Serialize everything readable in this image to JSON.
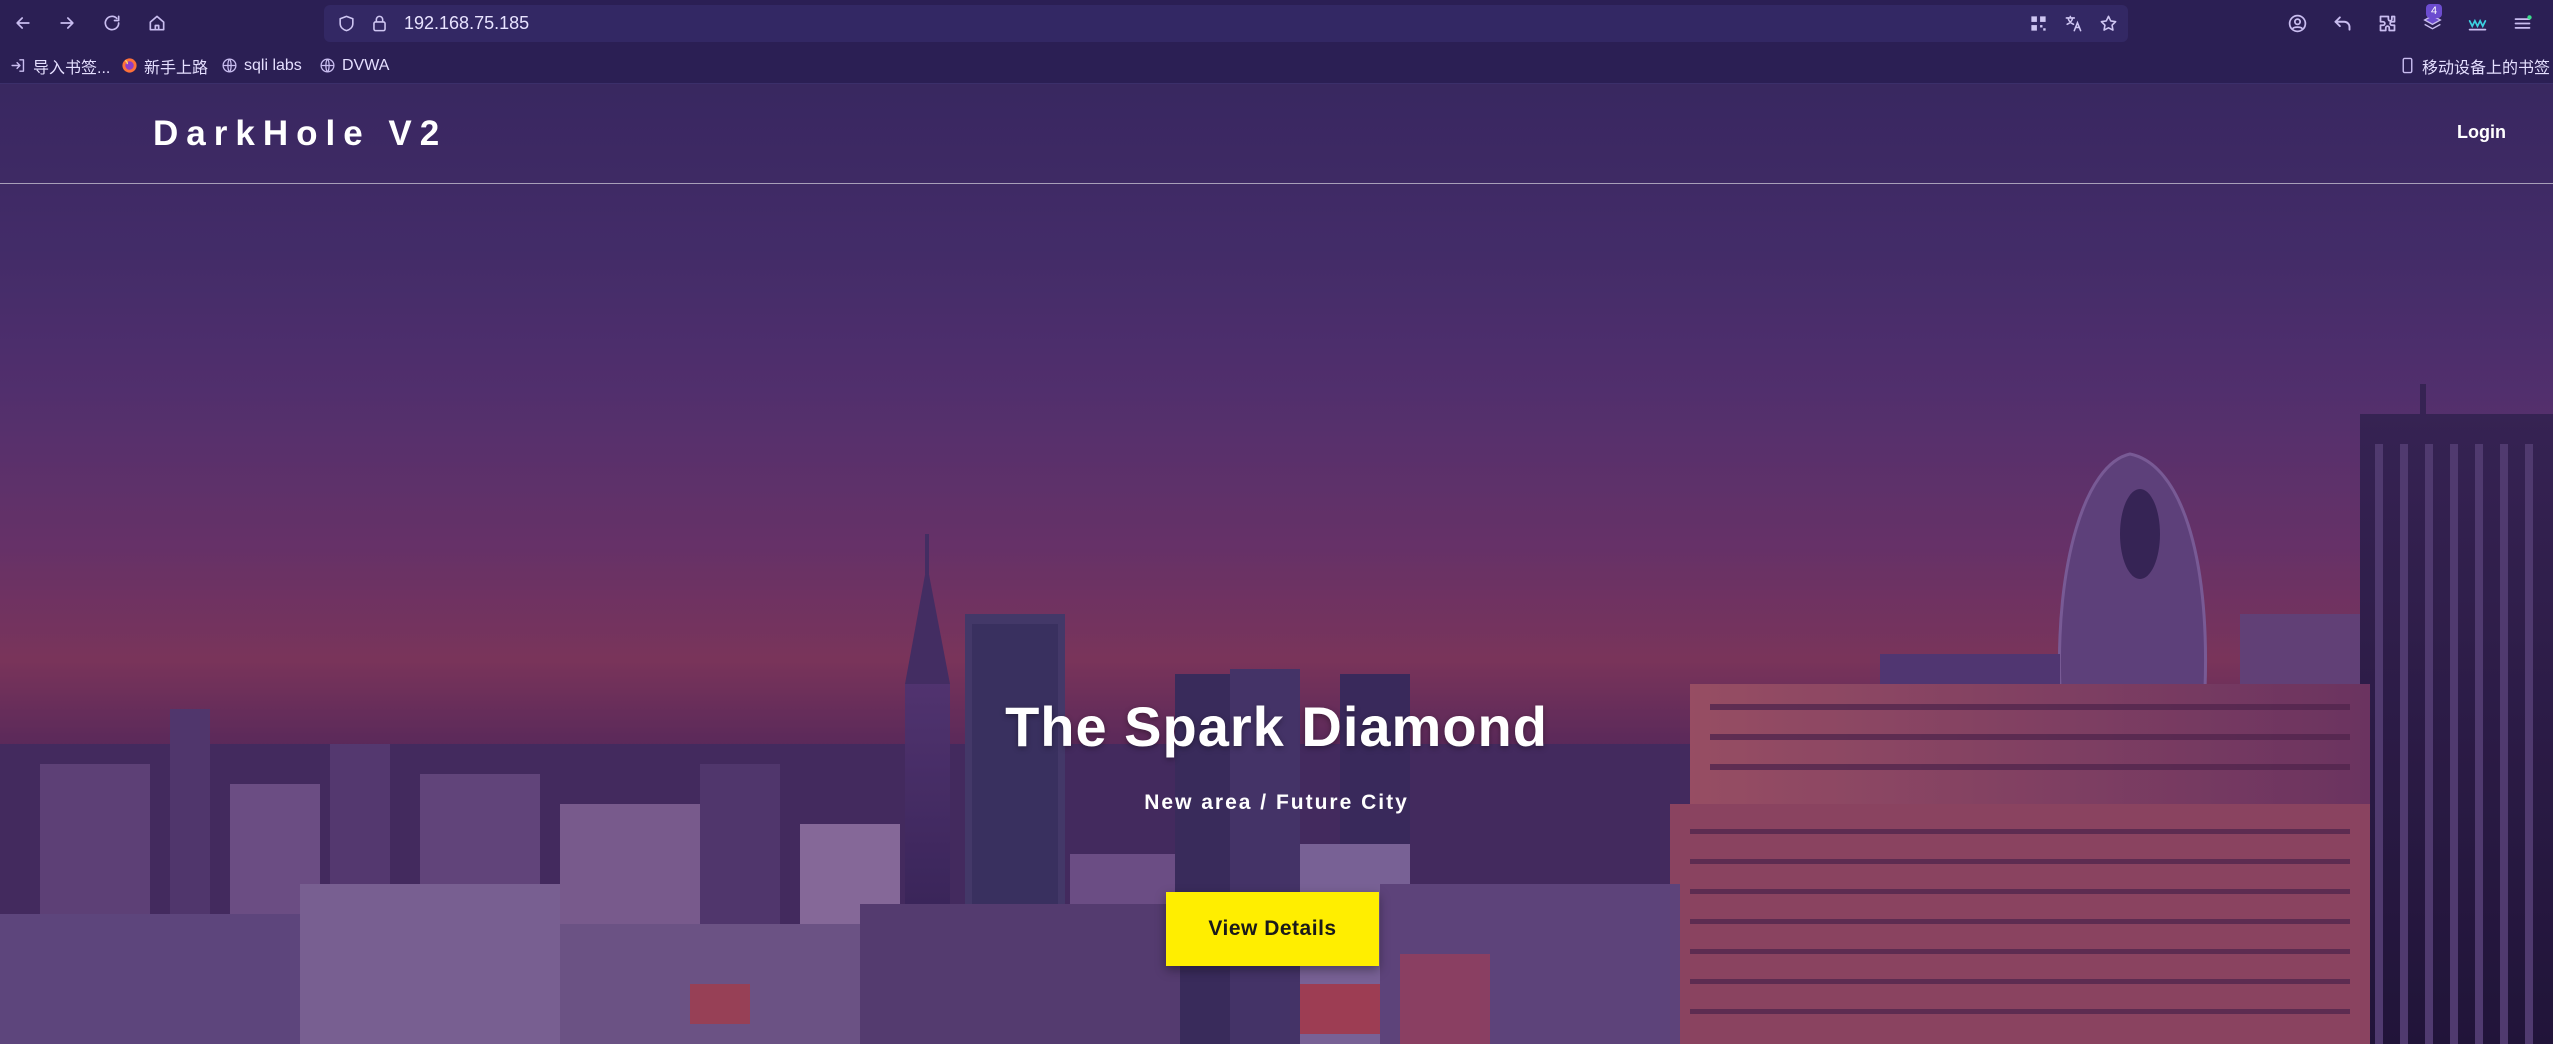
{
  "browser": {
    "url": "192.168.75.185",
    "extension_badge": "4",
    "bookmarks": [
      {
        "label": "导入书签...",
        "icon": "import-icon"
      },
      {
        "label": "新手上路",
        "icon": "firefox-icon"
      },
      {
        "label": "sqli labs",
        "icon": "globe-icon"
      },
      {
        "label": "DVWA",
        "icon": "globe-icon"
      }
    ],
    "mobile_bookmarks": "移动设备上的书签"
  },
  "site": {
    "brand": "DarkHole V2",
    "nav_login": "Login"
  },
  "hero": {
    "title": "The Spark Diamond",
    "subtitle": "New area / Future City",
    "cta_label": "View Details"
  },
  "colors": {
    "cta_background": "#ffee00",
    "browser_chrome": "#2b1f54",
    "urlbar": "#332864"
  }
}
